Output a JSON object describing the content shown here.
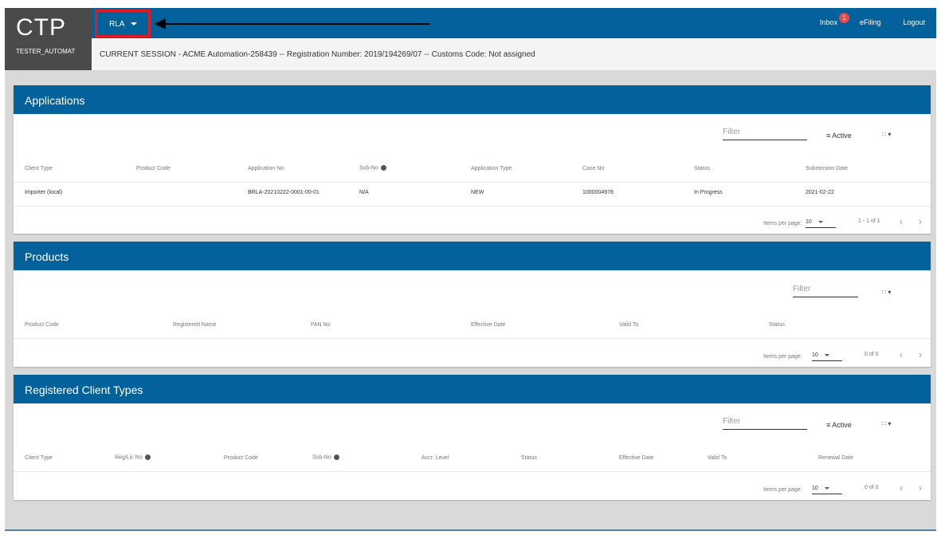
{
  "brand": {
    "logo": "CTP",
    "user": "TESTER_AUTOMAT"
  },
  "nav": {
    "module_label": "RLA",
    "inbox_label": "Inbox",
    "inbox_count": "1",
    "efiling_label": "eFiling",
    "logout_label": "Logout"
  },
  "session": {
    "text": "CURRENT SESSION - ACME Automation-258439 -- Registration Number: 2019/194269/07 -- Customs Code: Not assigned"
  },
  "applications": {
    "title": "Applications",
    "filter_placeholder": "Filter",
    "active_label": "Active",
    "columns": [
      "Client Type",
      "Product Code",
      "Application No",
      "Sub-No",
      "Application Type",
      "Case No",
      "Status",
      "Submission Date"
    ],
    "rows": [
      [
        "Importer (local)",
        "",
        "BRLA-20210222-0001-00-01",
        "N/A",
        "NEW",
        "1000004978",
        "In Progress",
        "2021-02-22"
      ]
    ],
    "items_per_page_label": "Items per page:",
    "items_per_page": "10",
    "range": "1 - 1 of 1"
  },
  "products": {
    "title": "Products",
    "filter_placeholder": "Filter",
    "columns": [
      "Product Code",
      "Registered Name",
      "FAN No",
      "Effective Date",
      "Valid To",
      "Status"
    ],
    "items_per_page_label": "Items per page:",
    "items_per_page": "10",
    "range": "0 of 0"
  },
  "client_types": {
    "title": "Registered Client Types",
    "filter_placeholder": "Filter",
    "active_label": "Active",
    "columns": [
      "Client Type",
      "Reg/Lic No",
      "Product Code",
      "Sub-No",
      "Accr. Level",
      "Status",
      "Effective Date",
      "Valid To",
      "Renewal Date"
    ],
    "items_per_page_label": "Items per page:",
    "items_per_page": "10",
    "range": "0 of 0"
  },
  "colors": {
    "primary": "#03619c",
    "highlight": "#e11b22",
    "badge": "#e84a4a"
  }
}
